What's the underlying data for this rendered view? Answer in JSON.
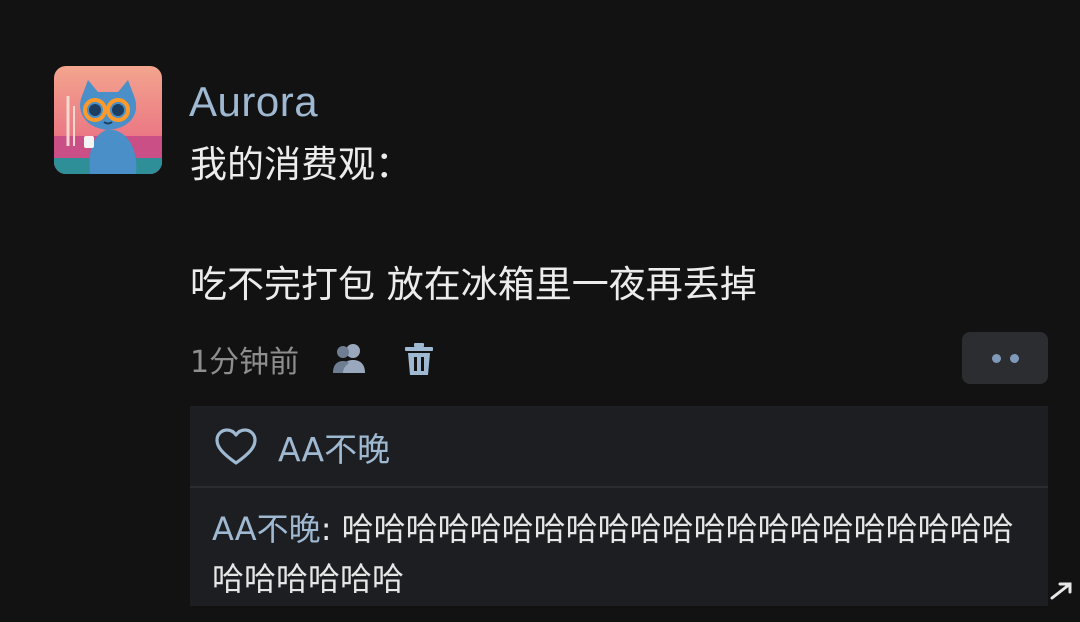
{
  "post": {
    "username": "Aurora",
    "line1": "我的消费观：",
    "line2": "吃不完打包 放在冰箱里一夜再丢掉",
    "timestamp": "1分钟前"
  },
  "icons": {
    "visibility": "friends-visibility-icon",
    "delete": "trash-icon",
    "more": "more-dots-icon",
    "like": "heart-outline-icon"
  },
  "likes": {
    "names": "AA不晚"
  },
  "comment": {
    "author": "AA不晚",
    "separator": ": ",
    "text": "哈哈哈哈哈哈哈哈哈哈哈哈哈哈哈哈哈哈哈哈哈哈哈哈哈哈哈"
  },
  "colors": {
    "background": "#121212",
    "link_blue": "#9fb9d2",
    "comment_box": "#1d1e21",
    "more_button": "#2b2d31"
  }
}
